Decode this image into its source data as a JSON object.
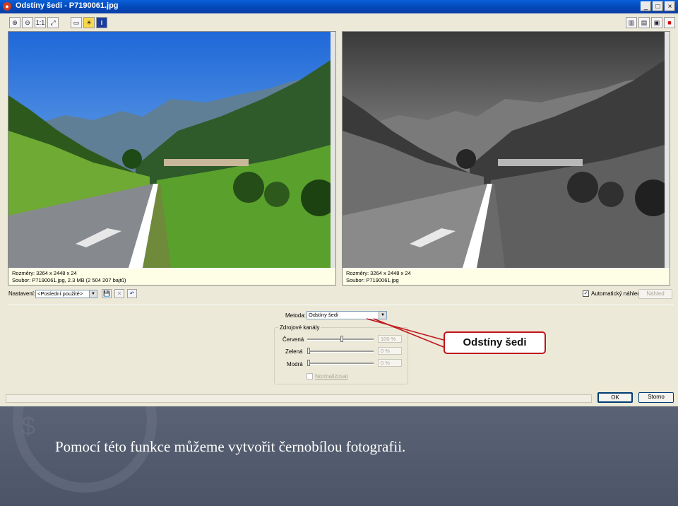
{
  "window": {
    "title": "Odstíny šedi - P7190061.jpg",
    "controls": [
      "_",
      "□",
      "×"
    ]
  },
  "toolbar": {
    "tools": [
      "zoom-in-icon",
      "zoom-out-icon",
      "actual-size-icon",
      "fit-window-icon",
      "picture-icon",
      "sun-icon",
      "info-icon"
    ],
    "view_modes": [
      "split-vertical-icon",
      "split-horizontal-icon",
      "single-view-icon",
      "compare-icon"
    ]
  },
  "left_pane": {
    "dimensions": "Rozměry: 3264 x 2448 x 24",
    "file": "Soubor: P7190061.jpg, 2.3 MB (2 504 207 bajtů)"
  },
  "right_pane": {
    "dimensions": "Rozměry: 3264 x 2448 x 24",
    "file": "Soubor: P7190061.jpg"
  },
  "settings": {
    "label": "Nastavení:",
    "value": "<Poslední použité>",
    "auto_preview_label": "Automatický náhled",
    "auto_preview_checked": true,
    "preview_button": "Náhled"
  },
  "method": {
    "label": "Metoda:",
    "value": "Odstíny šedi"
  },
  "channels": {
    "group_label": "Zdrojové kanály",
    "rows": [
      {
        "label": "Červená",
        "value": "100 %",
        "level": 0.5
      },
      {
        "label": "Zelená",
        "value": "0 %",
        "level": 0
      },
      {
        "label": "Modrá",
        "value": "0 %",
        "level": 0
      }
    ],
    "normalize_label": "Normalizovat"
  },
  "buttons": {
    "ok": "OK",
    "cancel": "Storno"
  },
  "callout": {
    "text": "Odstíny šedi",
    "border_color": "#c0141c"
  },
  "slide": {
    "caption": "Pomocí této funkce můžeme vytvořit černobílou fotografii."
  }
}
